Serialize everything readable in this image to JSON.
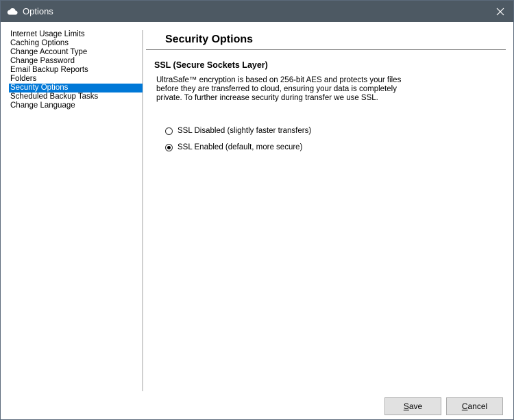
{
  "window": {
    "title": "Options",
    "app_icon": "cloud-icon",
    "close_icon": "close-icon"
  },
  "sidebar": {
    "items": [
      {
        "label": "Internet Usage Limits",
        "selected": false
      },
      {
        "label": "Caching Options",
        "selected": false
      },
      {
        "label": "Change Account Type",
        "selected": false
      },
      {
        "label": "Change Password",
        "selected": false
      },
      {
        "label": "Email Backup Reports",
        "selected": false
      },
      {
        "label": "Folders",
        "selected": false
      },
      {
        "label": "Security Options",
        "selected": true
      },
      {
        "label": "Scheduled Backup Tasks",
        "selected": false
      },
      {
        "label": "Change Language",
        "selected": false
      }
    ]
  },
  "content": {
    "title": "Security Options",
    "subheading": "SSL (Secure Sockets Layer)",
    "description": "UltraSafe™ encryption is based on 256-bit AES and protects your files before they are transferred to cloud, ensuring your data is completely private. To further increase security during transfer we use SSL.",
    "options": [
      {
        "label": "SSL Disabled (slightly faster transfers)",
        "checked": false
      },
      {
        "label": "SSL Enabled (default, more secure)",
        "checked": true
      }
    ]
  },
  "buttons": {
    "save": {
      "mnemonic": "S",
      "rest": "ave"
    },
    "cancel": {
      "mnemonic": "C",
      "rest": "ancel"
    }
  }
}
